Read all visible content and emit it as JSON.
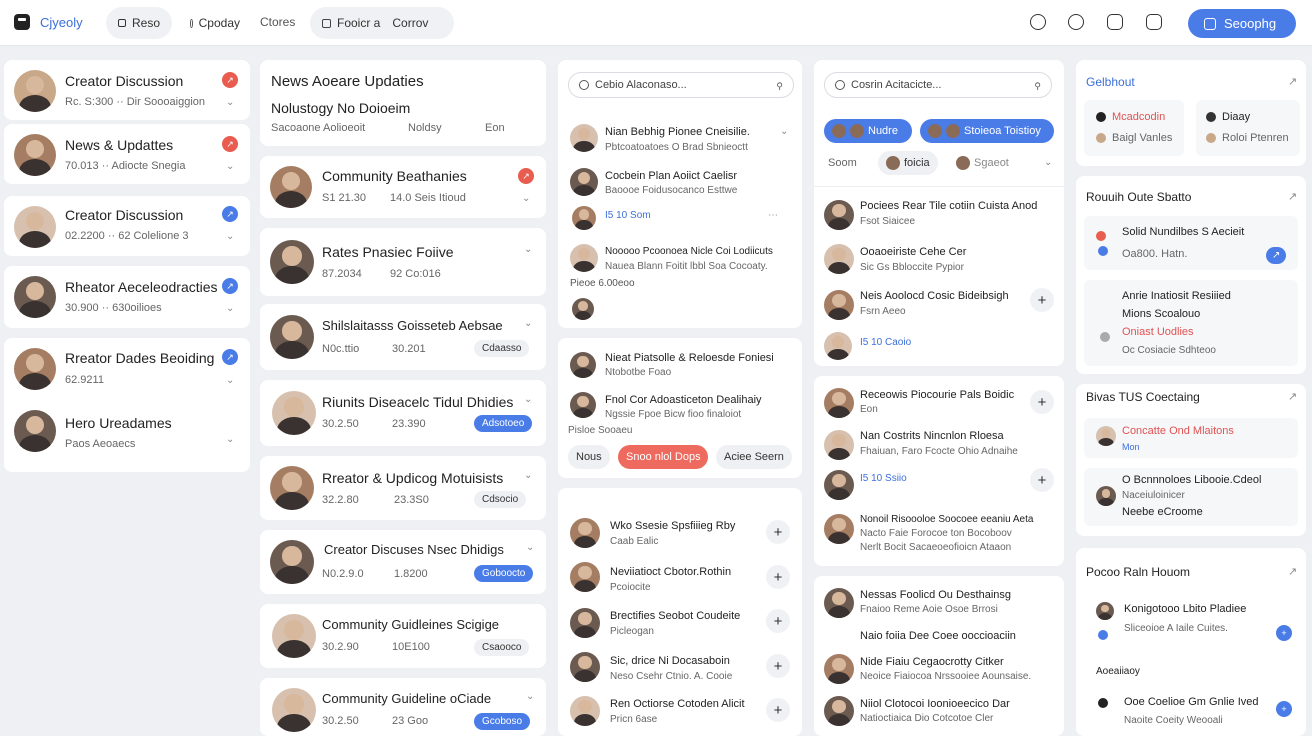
{
  "topbar": {
    "brand": "Cjyeoly",
    "pills": [
      "Reso",
      "Cpoday",
      "Ctores",
      "Fooicr a",
      "Corrov"
    ],
    "cta": "Seoophg"
  },
  "col1": [
    {
      "title": "Creator Discussion",
      "meta": "Rc. S:300 ·· Dir Soooaiggion",
      "badge": "red"
    },
    {
      "title": "News & Updattes",
      "meta": "70.013 ·· Adiocte Snegia",
      "badge": "red"
    },
    {
      "title": "Creator Discussion",
      "meta": "02.2200 ·· 62 Colelione 3",
      "badge": "blue"
    },
    {
      "title": "Rheator Aeceleodracties",
      "meta": "30.900 ·· 630oilioes",
      "badge": "blue"
    },
    {
      "title": "Rreator Dades Beoiding",
      "meta": "62.9211",
      "badge": "blue"
    },
    {
      "title": "Hero Ureadames",
      "meta": "Paos Aeoaecs",
      "badge": ""
    }
  ],
  "col2": {
    "header": {
      "title": "News Aoeare Updaties",
      "sub": "Nolustogy No Doioeim",
      "line": "Sacoaone Aolioeoit",
      "tab1": "Noldsy",
      "tab2": "Eon"
    },
    "items": [
      {
        "title": "Community Beathanies",
        "n1": "S1 21.30",
        "n2": "14.0 Seis Itioud",
        "tag": ""
      },
      {
        "title": "Rates Pnasiec Foiive",
        "n1": "87.2034",
        "n2": "92 Co:016",
        "tag": ""
      },
      {
        "title": "Shilslaitasss Goisseteb Aebsae",
        "n1": "N0c.ttio",
        "n2": "30.201",
        "tag": "Cdaasso"
      },
      {
        "title": "Riunits Diseacelc Tidul Dhidies",
        "n1": "30.2.50",
        "n2": "23.390",
        "tag": "Adsotoeo"
      },
      {
        "title": "Rreator & Updicog Motuisists",
        "n1": "32.2.80",
        "n2": "23.3S0",
        "tag": "Cdsocio"
      },
      {
        "title": "Creator Discuses Nsec Dhidigs",
        "n1": "N0.2.9.0",
        "n2": "1.8200",
        "tag": "Goboocto"
      },
      {
        "title": "Community Guidleines Scigige",
        "n1": "30.2.90",
        "n2": "10E100",
        "tag": "Csaooco"
      },
      {
        "title": "Community Guideline oCiade",
        "n1": "30.2.50",
        "n2": "23 Goo",
        "tag": "Gcoboso"
      }
    ]
  },
  "col3": {
    "search": "Cebio Alaconaso...",
    "posts": [
      {
        "title": "Nian Bebhig Pionee Cneisilie.",
        "sub": "Pbtcoatoatoes O Brad Sbnieoctt"
      },
      {
        "title": "Cocbein Plan Aoiict Caelisr",
        "sub": "Baoooe Foidusocanco Esttwe"
      },
      {
        "title": "I5 10  Som",
        "sub": ""
      },
      {
        "title": "Nooooo Pcoonoea Nicle Coi Lodiicuts",
        "sub": "Nauea Blann Foitit lbbl Soa Cocoaty."
      },
      {
        "title": "Pieoe  6.00eoo",
        "sub": ""
      }
    ],
    "card2": [
      {
        "title": "Nieat Piatsolle & Reloesde Foniesi",
        "sub": "Ntobotbe Foao"
      },
      {
        "title": "Fnol Cor Adoasticeton Dealihaiy",
        "sub": "Ngssie Fpoe Bicw fioo finaloiot"
      }
    ],
    "card2_extra": "Pisloe  Sooaeu",
    "chips": [
      "Nous",
      "Snoo nlol Dops",
      "Aciee Seern"
    ],
    "list": [
      {
        "title": "Wko Ssesie Spsfiiieg Rby",
        "sub": "Caab Ealic"
      },
      {
        "title": "Neviiatioct Cbotor.Rothin",
        "sub": "Pcoiocite"
      },
      {
        "title": "Brectifies Seobot Coudeite",
        "sub": "Picleogan"
      },
      {
        "title": "Sic, drice Ni Docasaboin",
        "sub": "Neso Csehr Ctnio. A. Cooie"
      },
      {
        "title": "Ren Octiorse Cotoden Alicit",
        "sub": "Pricn 6ase"
      }
    ]
  },
  "col4": {
    "search": "Cosrin Acitacicte...",
    "chips": [
      "Nudre",
      "Stoieoa Toistioy"
    ],
    "row": [
      "Soom",
      "foicia",
      "Sgaeot"
    ],
    "posts": [
      {
        "title": "Pociees Rear Tile cotiin Cuista Anod",
        "sub": "Fsot Siaicee"
      },
      {
        "title": "Ooaoeiriste Cehe Cer",
        "sub": "Sic Gs Bbloccite Pypior"
      },
      {
        "title": "Neis Aoolocd Cosic Bideibsigh",
        "sub": "Fsrn Aeeo"
      },
      {
        "title": "I5 10  Caoio",
        "sub": ""
      }
    ],
    "card2": [
      {
        "title": "Receowis Piocourie Pals Boidic",
        "sub": "Eon"
      },
      {
        "title": "Nan Costrits Nincnlon Rloesa",
        "sub": "Fhaiuan,  Faro Fcocte Ohio Adnaihe"
      },
      {
        "title": "I5 10 Ssiio",
        "sub": ""
      },
      {
        "title": "Nonoil Risoooloe Soocoee eeaniu Aeta",
        "sub": "Nacto Faie Forocoe ton Bocoboov"
      },
      {
        "title": "Nerlt Bocit Sacaeoeofioicn Ataaon",
        "sub": ""
      }
    ],
    "card3": [
      {
        "title": "Nessas Foolicd Ou Desthainsg",
        "sub": "Fnaioo Reme Aoie Osoe Brrosi"
      },
      {
        "title": "Naio foiia Dee Coee ooccioaciin",
        "sub": ""
      },
      {
        "title": "Nide Fiaiu Cegaocrotty Citker",
        "sub": "Neoice Fiaiocoa Nrssooiee Aounsaise."
      },
      {
        "title": "Niiol Clotocoi Ioonioeecico Dar",
        "sub": "Natioctiaica Dio Cotcotoe Cler"
      }
    ]
  },
  "col5": {
    "s1": {
      "title": "Gelbhout",
      "items": [
        "Mcadcodin",
        "Diaay",
        "Baigl Vanles",
        "Roloi Ptenren"
      ]
    },
    "s2": {
      "title": "Rouuih Oute Sbatto",
      "items": [
        {
          "title": "Solid Nundilbes S Aecieit",
          "sub": "Oa800. Hatn."
        },
        {
          "title": "Anrie Inatiosit Resiiied",
          "sub": "Mions Scoalouo",
          "red": "Oniast Uodlies",
          "foot": "Oc Cosiacie Sdhteoo"
        }
      ]
    },
    "s3": {
      "title": "Bivas TUS Coectaing",
      "items": [
        {
          "title": "Concatte Ond Mlaitons",
          "sub": "Mon"
        },
        {
          "title": "O Bcnnnoloes Libooie.Cdeol",
          "sub": "Naceiuloinicer",
          "foot": "Neebe eCroome"
        }
      ]
    },
    "s4": {
      "title": "Pocoo Raln Houom",
      "items": [
        {
          "title": "Konigotooo Lbito Pladiee",
          "sub": "Sliceoioe A Iaile Cuites."
        },
        {
          "title": "Aoeaiiaoy",
          "sub": ""
        },
        {
          "title": "Ooe Coelioe Gm Gnlie Ived",
          "sub": "Naoite Coeity Weooali"
        }
      ]
    }
  }
}
